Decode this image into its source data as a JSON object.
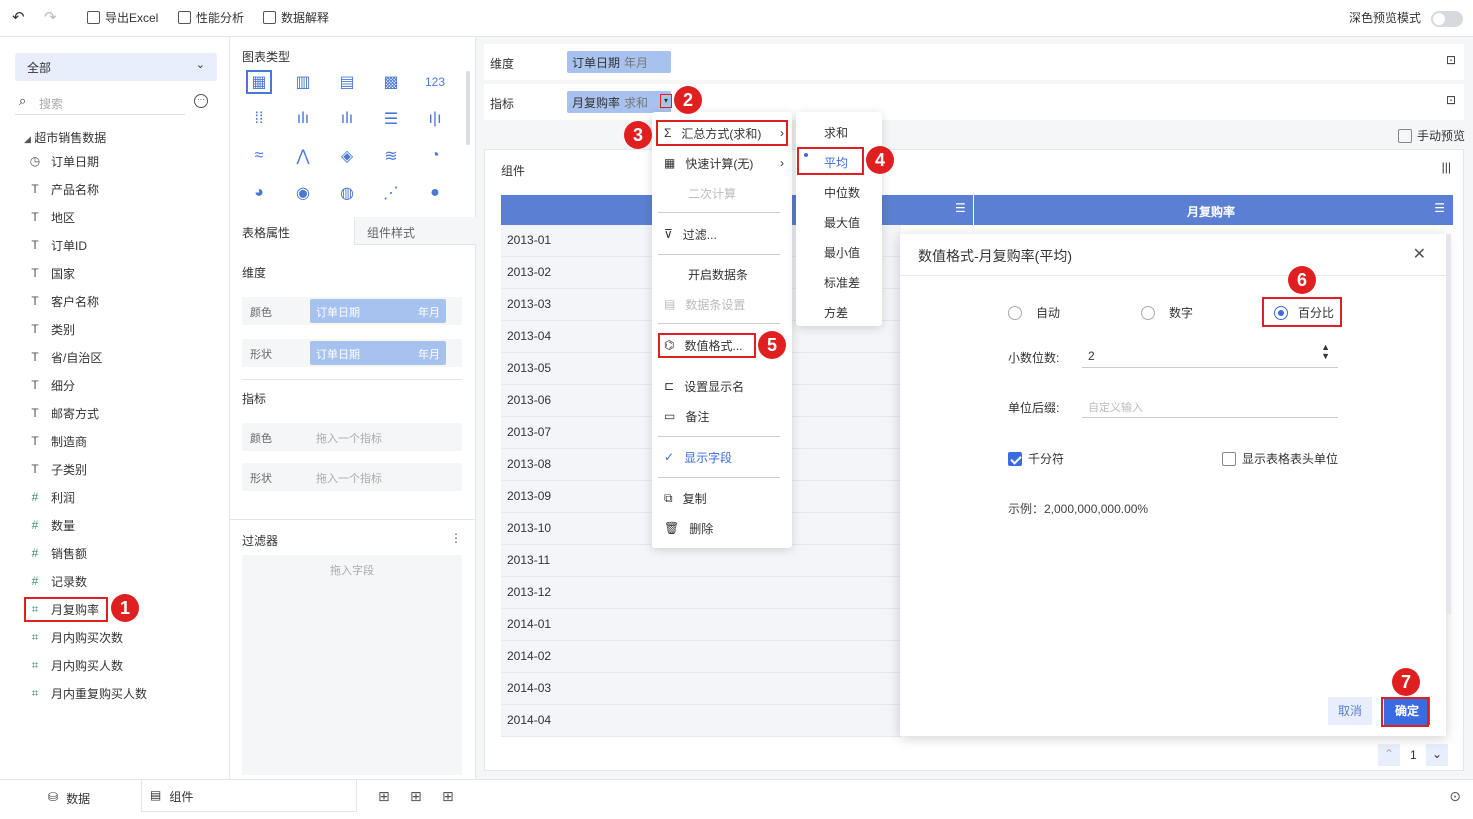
{
  "toolbar": {
    "export_excel": "导出Excel",
    "perf": "性能分析",
    "explain": "数据解释",
    "dark_preview": "深色预览模式"
  },
  "left": {
    "scope": "全部",
    "search_placeholder": "搜索",
    "root": "超市销售数据",
    "fields": [
      {
        "label": "订单日期",
        "icon": "clock"
      },
      {
        "label": "产品名称",
        "icon": "T"
      },
      {
        "label": "地区",
        "icon": "T"
      },
      {
        "label": "订单ID",
        "icon": "T"
      },
      {
        "label": "国家",
        "icon": "T"
      },
      {
        "label": "客户名称",
        "icon": "T"
      },
      {
        "label": "类别",
        "icon": "T"
      },
      {
        "label": "省/自治区",
        "icon": "T"
      },
      {
        "label": "细分",
        "icon": "T"
      },
      {
        "label": "邮寄方式",
        "icon": "T"
      },
      {
        "label": "制造商",
        "icon": "T"
      },
      {
        "label": "子类别",
        "icon": "T"
      },
      {
        "label": "利润",
        "icon": "#"
      },
      {
        "label": "数量",
        "icon": "#"
      },
      {
        "label": "销售额",
        "icon": "#"
      },
      {
        "label": "记录数",
        "icon": "#"
      },
      {
        "label": "月复购率",
        "icon": "calc"
      },
      {
        "label": "月内购买次数",
        "icon": "calc"
      },
      {
        "label": "月内购买人数",
        "icon": "calc"
      },
      {
        "label": "月内重复购买人数",
        "icon": "calc"
      }
    ]
  },
  "mid": {
    "chart_type_title": "图表类型",
    "tab_props": "表格属性",
    "tab_style": "组件样式",
    "dim_title": "维度",
    "color": "颜色",
    "shape": "形状",
    "dim_chip": "订单日期",
    "dim_chip_sub": "年月",
    "measure_title": "指标",
    "drag_measure": "拖入一个指标",
    "filter_title": "过滤器",
    "drag_field": "拖入字段"
  },
  "right": {
    "dim_label": "维度",
    "dim_chip": "订单日期",
    "dim_chip_sub": "年月",
    "measure_label": "指标",
    "measure_chip": "月复购率",
    "measure_chip_sub": "求和",
    "manual_preview": "手动预览",
    "component": "组件",
    "col2_header": "月复购率",
    "rows": [
      "2013-01",
      "2013-02",
      "2013-03",
      "2013-04",
      "2013-05",
      "2013-06",
      "2013-07",
      "2013-08",
      "2013-09",
      "2013-10",
      "2013-11",
      "2013-12",
      "2014-01",
      "2014-02",
      "2014-03",
      "2014-04"
    ],
    "page": "1"
  },
  "menu": {
    "items": [
      "汇总方式(求和)",
      "快速计算(无)",
      "二次计算",
      "过滤...",
      "开启数据条",
      "数据条设置",
      "数值格式...",
      "设置显示名",
      "备注",
      "显示字段",
      "复制",
      "删除"
    ],
    "sub": [
      "求和",
      "平均",
      "中位数",
      "最大值",
      "最小值",
      "标准差",
      "方差"
    ]
  },
  "dialog": {
    "title": "数值格式-月复购率(平均)",
    "auto": "自动",
    "number": "数字",
    "percent": "百分比",
    "decimals_label": "小数位数:",
    "decimals_value": "2",
    "suffix_label": "单位后缀:",
    "suffix_placeholder": "自定义输入",
    "thousands": "千分符",
    "show_header_unit": "显示表格表头单位",
    "example": "示例：2,000,000,000.00%",
    "cancel": "取消",
    "ok": "确定"
  },
  "markers": [
    "1",
    "2",
    "3",
    "4",
    "5",
    "6",
    "7"
  ],
  "bottom": {
    "data_tab": "数据",
    "component_tab": "组件"
  },
  "colors": {
    "accent": "#3a6be0",
    "header": "#5b7fd2",
    "chip": "#a8c2ef",
    "highlight": "#e02020"
  }
}
